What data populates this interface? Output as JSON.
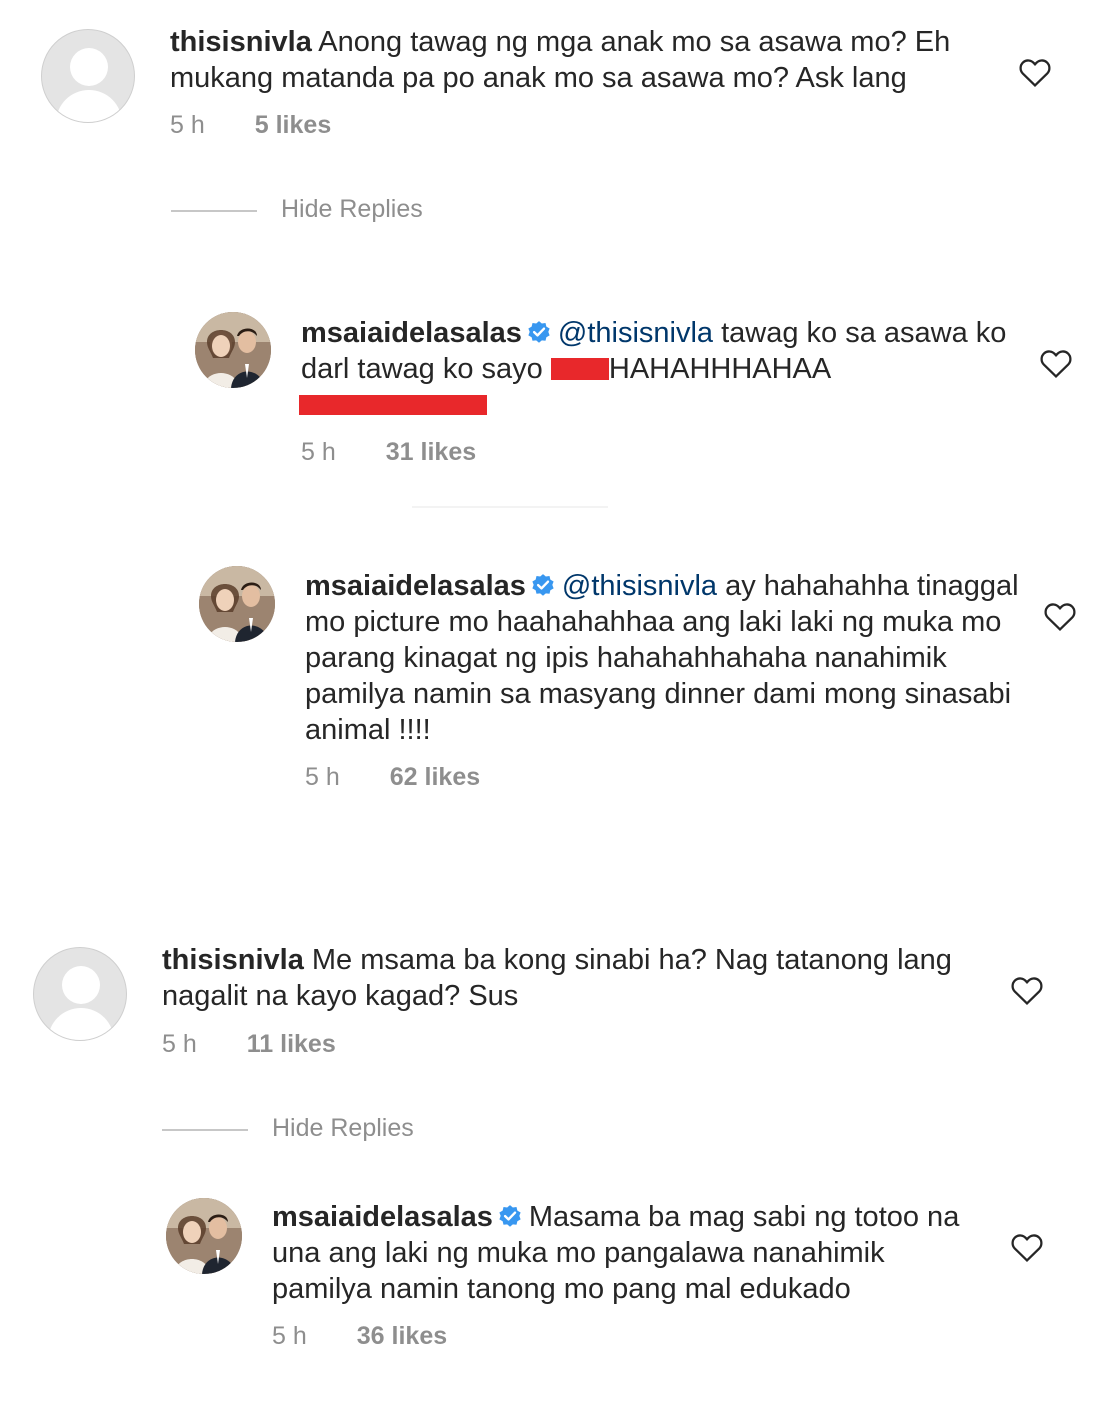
{
  "comments": [
    {
      "username": "thisisnivla",
      "text": "Anong tawag ng mga anak mo sa asawa mo? Eh mukang matanda pa po anak mo sa asawa mo? Ask lang",
      "time": "5 h",
      "likes": "5 likes",
      "hide_replies": "Hide Replies",
      "replies": [
        {
          "username": "msaiaidelasalas",
          "mention": "@thisisnivla",
          "text_1": "tawag ko sa asawa ko darl tawag ko sayo",
          "text_2": "HAHAHHHAHAA",
          "time": "5 h",
          "likes": "31 likes"
        },
        {
          "username": "msaiaidelasalas",
          "mention": "@thisisnivla",
          "text": "ay hahahahha tinaggal mo picture mo haahahahhaa ang laki laki ng muka mo parang kinagat ng ipis hahahahhahaha nanahimik pamilya namin sa masyang dinner  dami mong sinasabi animal !!!!",
          "time": "5 h",
          "likes": "62 likes"
        }
      ]
    },
    {
      "username": "thisisnivla",
      "text": "Me msama ba kong sinabi ha? Nag tatanong lang nagalit na kayo kagad? Sus",
      "time": "5 h",
      "likes": "11 likes",
      "hide_replies": "Hide Replies",
      "replies": [
        {
          "username": "msaiaidelasalas",
          "text": "Masama ba mag sabi ng totoo na una ang laki ng muka mo pangalawa nanahimik pamilya namin tanong mo pang mal edukado",
          "time": "5 h",
          "likes": "36 likes"
        }
      ]
    }
  ],
  "colors": {
    "verified": "#3897f0",
    "mention": "#00376b",
    "redaction": "#e8282b",
    "meta": "#8e8e8e"
  },
  "icons": {
    "like": "heart-outline-icon",
    "verified": "verified-badge-icon",
    "default_avatar": "default-avatar-icon"
  }
}
